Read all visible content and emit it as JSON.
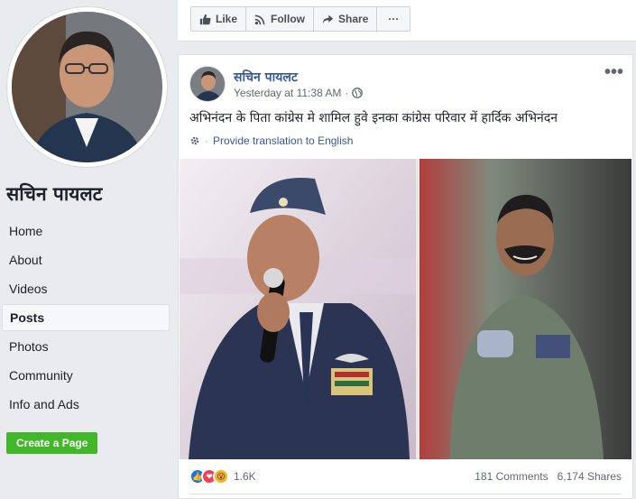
{
  "sidebar": {
    "page_name": "सचिन पायलट",
    "nav": [
      {
        "label": "Home",
        "active": false
      },
      {
        "label": "About",
        "active": false
      },
      {
        "label": "Videos",
        "active": false
      },
      {
        "label": "Posts",
        "active": true
      },
      {
        "label": "Photos",
        "active": false
      },
      {
        "label": "Community",
        "active": false
      },
      {
        "label": "Info and Ads",
        "active": false
      }
    ],
    "create_page_label": "Create a Page"
  },
  "actionbar": {
    "like_label": "Like",
    "follow_label": "Follow",
    "share_label": "Share",
    "more_label": "···"
  },
  "post": {
    "author": "सचिन पायलट",
    "timestamp": "Yesterday at 11:38 AM",
    "separator": "·",
    "text": "अभिनंदन के पिता कांग्रेस मे शामिल हुवे इनका कांग्रेस परिवार में हार्दिक अभिनंदन",
    "translate_label": "Provide translation to English",
    "more_label": "•••",
    "reactions": [
      "like",
      "love",
      "wow"
    ],
    "reaction_count": "1.6K",
    "comments": "181 Comments",
    "shares": "6,174 Shares"
  },
  "colors": {
    "link": "#385898",
    "green_button": "#42b72a",
    "like_blue": "#1b74e4",
    "love_red": "#f33e58",
    "wow_yellow": "#f7b125"
  }
}
